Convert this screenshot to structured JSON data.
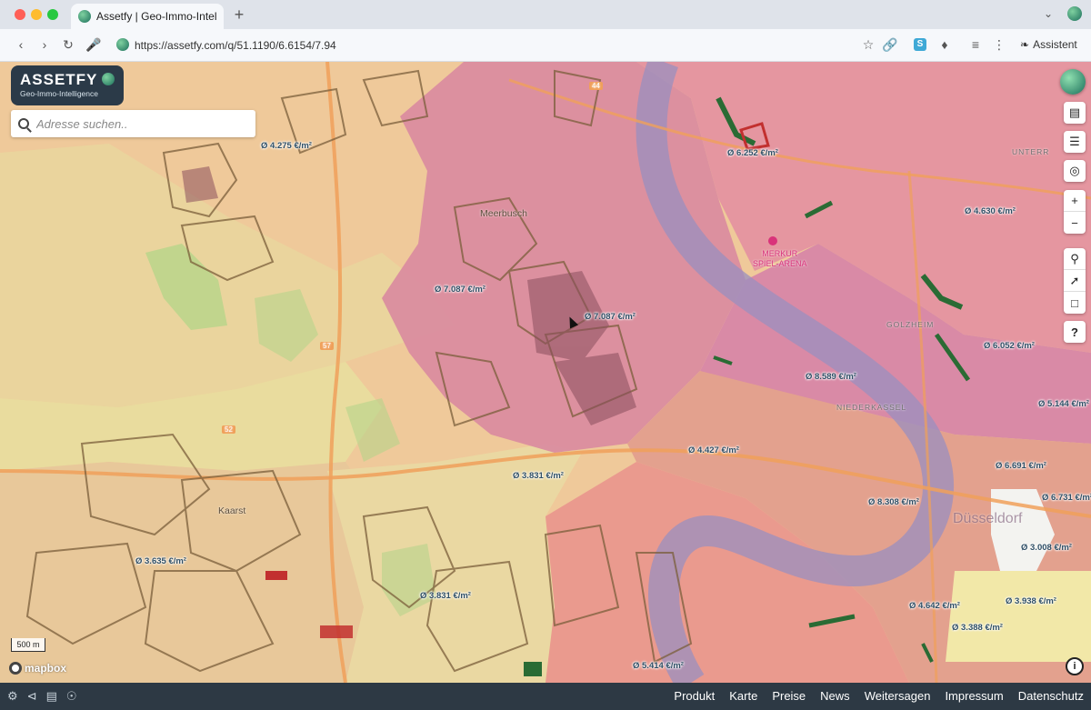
{
  "browser": {
    "tab_title": "Assetfy | Geo-Immo-Intellige",
    "new_tab": "+",
    "url": "https://assetfy.com/q/51.1190/6.6154/7.94",
    "assistant_label": "Assistent",
    "extension_badge": "S"
  },
  "brand": {
    "name": "ASSETFY",
    "tagline": "Geo-Immo-Intelligence"
  },
  "search": {
    "placeholder": "Adresse suchen.."
  },
  "places": {
    "meerbusch": "Meerbusch",
    "kaarst": "Kaarst",
    "merkur": "MERKUR",
    "spiel_arena": "SPIEL-ARENA",
    "golzheim": "GOLZHEIM",
    "niederkassel": "NIEDERKASSEL",
    "unterr": "UNTERR",
    "duesseldorf": "Düsseldorf"
  },
  "price_labels": [
    "Ø 4.275 €/m²",
    "Ø 6.252 €/m²",
    "Ø 4.630 €/m²",
    "Ø 7.087 €/m²",
    "Ø 7.087 €/m²",
    "Ø 6.052 €/m²",
    "Ø 8.589 €/m²",
    "Ø 5.144 €/m²",
    "Ø 4.427 €/m²",
    "Ø 3.831 €/m²",
    "Ø 6.691 €/m²",
    "Ø 8.308 €/m²",
    "Ø 6.731 €/m²",
    "Ø 3.008 €/m²",
    "Ø 3.635 €/m²",
    "Ø 3.831 €/m²",
    "Ø 4.642 €/m²",
    "Ø 3.938 €/m²",
    "Ø 3.388 €/m²",
    "Ø 5.414 €/m²"
  ],
  "road_shields": [
    "57",
    "52",
    "44"
  ],
  "map_controls": {
    "globe": "globe-icon",
    "map": "map-icon",
    "layers": "layers-icon",
    "locate": "crosshair-icon",
    "zoom_in": "+",
    "zoom_out": "−",
    "help": "?"
  },
  "scale_label": "500 m",
  "mapbox_label": "mapbox",
  "info": "i",
  "footer": {
    "links": [
      "Produkt",
      "Karte",
      "Preise",
      "News",
      "Weitersagen",
      "Impressum",
      "Datenschutz"
    ]
  },
  "colors": {
    "brand_dark": "#2b3a48",
    "footer_bg": "#2d3944",
    "zone_high": "#d98aa0",
    "zone_mid": "#e8a38a",
    "zone_low": "#efc99a",
    "zone_very_low": "#e8dd9c",
    "river": "#9a8fbf"
  }
}
